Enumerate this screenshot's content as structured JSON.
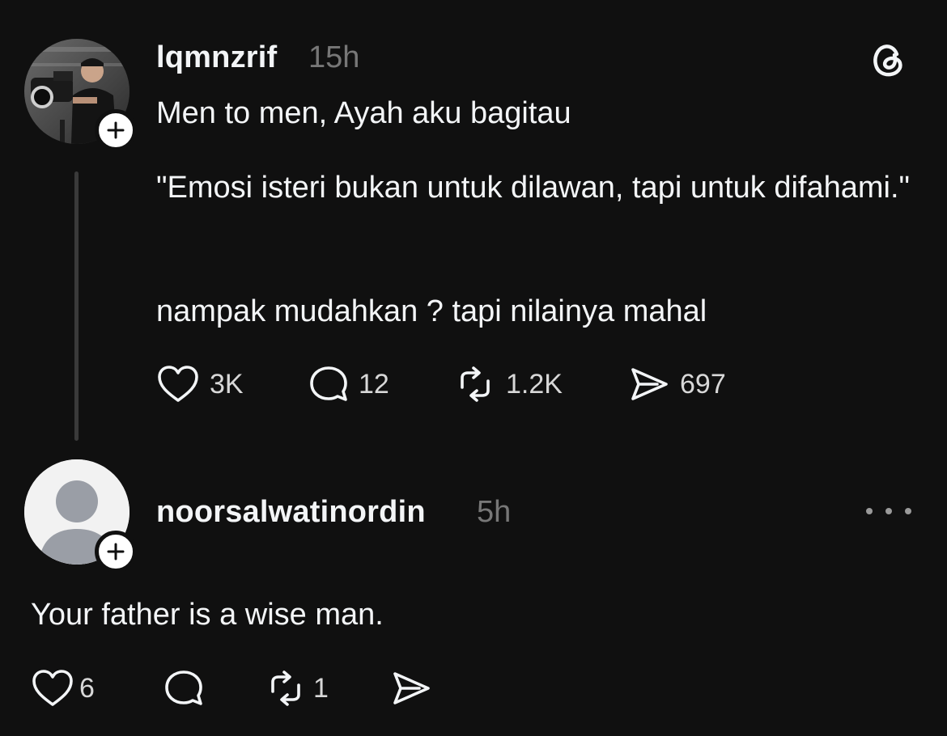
{
  "post": {
    "username": "lqmnzrif",
    "timestamp": "15h",
    "lines": [
      "Men to men, Ayah aku bagitau",
      "\"Emosi isteri bukan untuk dilawan, tapi untuk difahami.\"",
      "nampak mudahkan ? tapi nilainya mahal"
    ],
    "likes": "3K",
    "replies": "12",
    "reposts": "1.2K",
    "shares": "697"
  },
  "reply": {
    "username": "noorsalwatinordin",
    "timestamp": "5h",
    "text": "Your father is a wise man.",
    "likes": "6",
    "reposts": "1"
  },
  "icons": {
    "app": "threads-logo-icon",
    "like": "heart-icon",
    "reply": "comment-bubble-icon",
    "repost": "repost-icon",
    "share": "send-icon",
    "more": "more-dots-icon",
    "follow": "plus-icon"
  },
  "colors": {
    "background": "#101010",
    "text": "#f3f5f7",
    "muted": "#777777",
    "thread_line": "#3a3a3a"
  }
}
